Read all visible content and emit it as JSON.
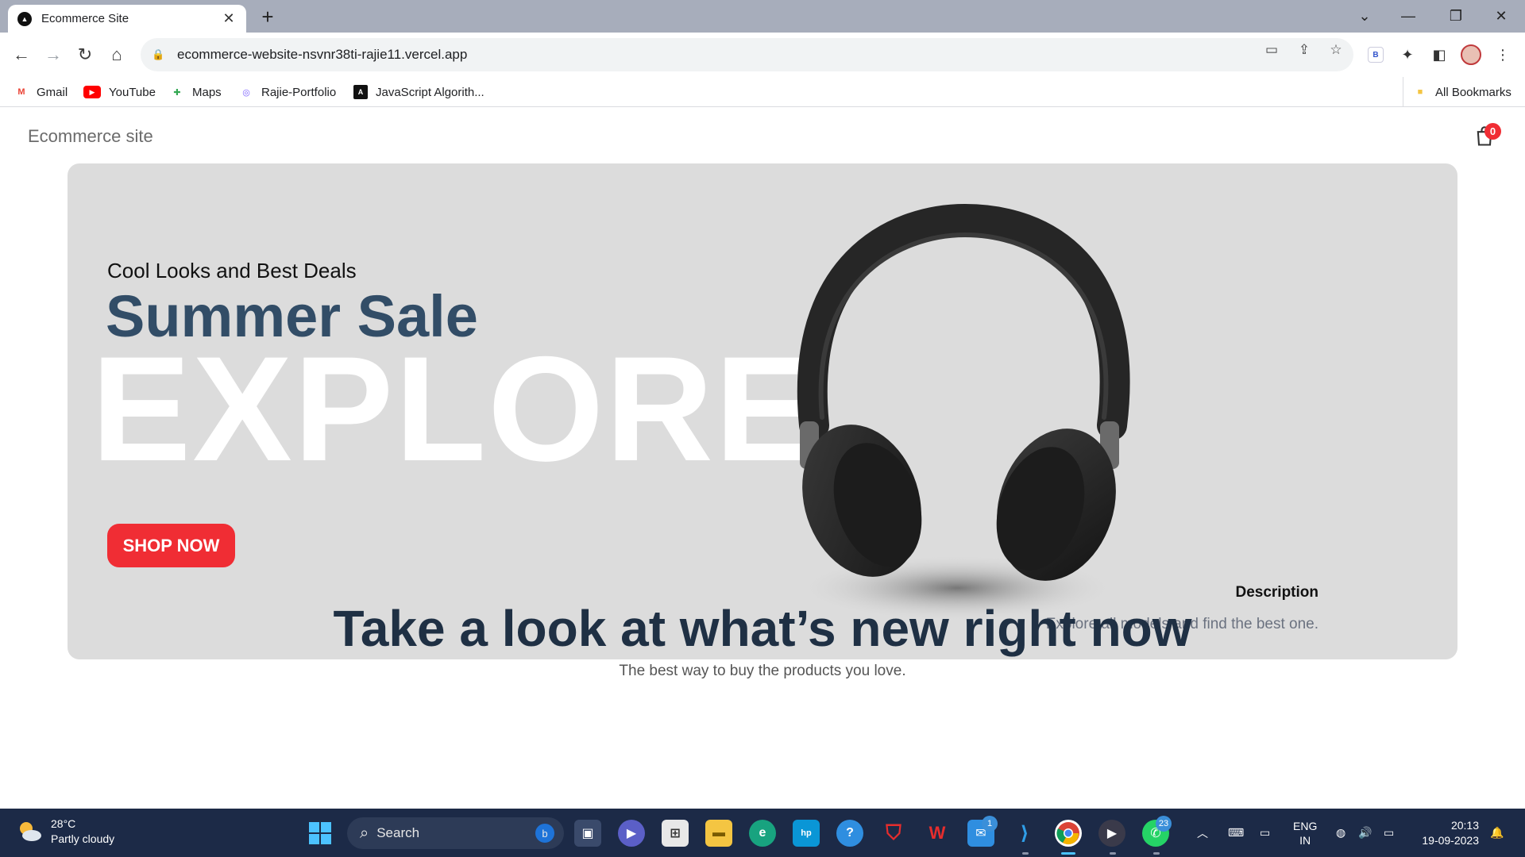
{
  "browser": {
    "tab_title": "Ecommerce Site",
    "new_tab_label": "+",
    "url": "ecommerce-website-nsvnr38ti-rajie11.vercel.app",
    "bookmarks": [
      {
        "label": "Gmail",
        "icon": "gmail-icon"
      },
      {
        "label": "YouTube",
        "icon": "youtube-icon"
      },
      {
        "label": "Maps",
        "icon": "maps-icon"
      },
      {
        "label": "Rajie-Portfolio",
        "icon": "portfolio-icon"
      },
      {
        "label": "JavaScript Algorith...",
        "icon": "js-algorithm-icon"
      }
    ],
    "all_bookmarks": "All Bookmarks",
    "extension_badge": "B"
  },
  "site": {
    "title": "Ecommerce site",
    "cart_count": "0"
  },
  "hero": {
    "small_text": "Cool Looks and Best Deals",
    "mid_text": "Summer Sale",
    "large_text": "EXPLORE",
    "button_label": "SHOP NOW",
    "desc_title": "Description",
    "desc_text": "Explore all models and find the best one."
  },
  "section": {
    "title": "Take a look at what’s new right now",
    "subtitle": "The best way to buy the products you love."
  },
  "taskbar": {
    "temperature": "28°C",
    "weather": "Partly cloudy",
    "search_placeholder": "Search",
    "mail_badge": "1",
    "whatsapp_badge": "23",
    "language": "ENG",
    "region": "IN",
    "time": "20:13",
    "date": "19-09-2023"
  },
  "colors": {
    "accent_red": "#f02d34",
    "hero_bg": "#dcdcdc",
    "heading_blue": "#324d67"
  }
}
